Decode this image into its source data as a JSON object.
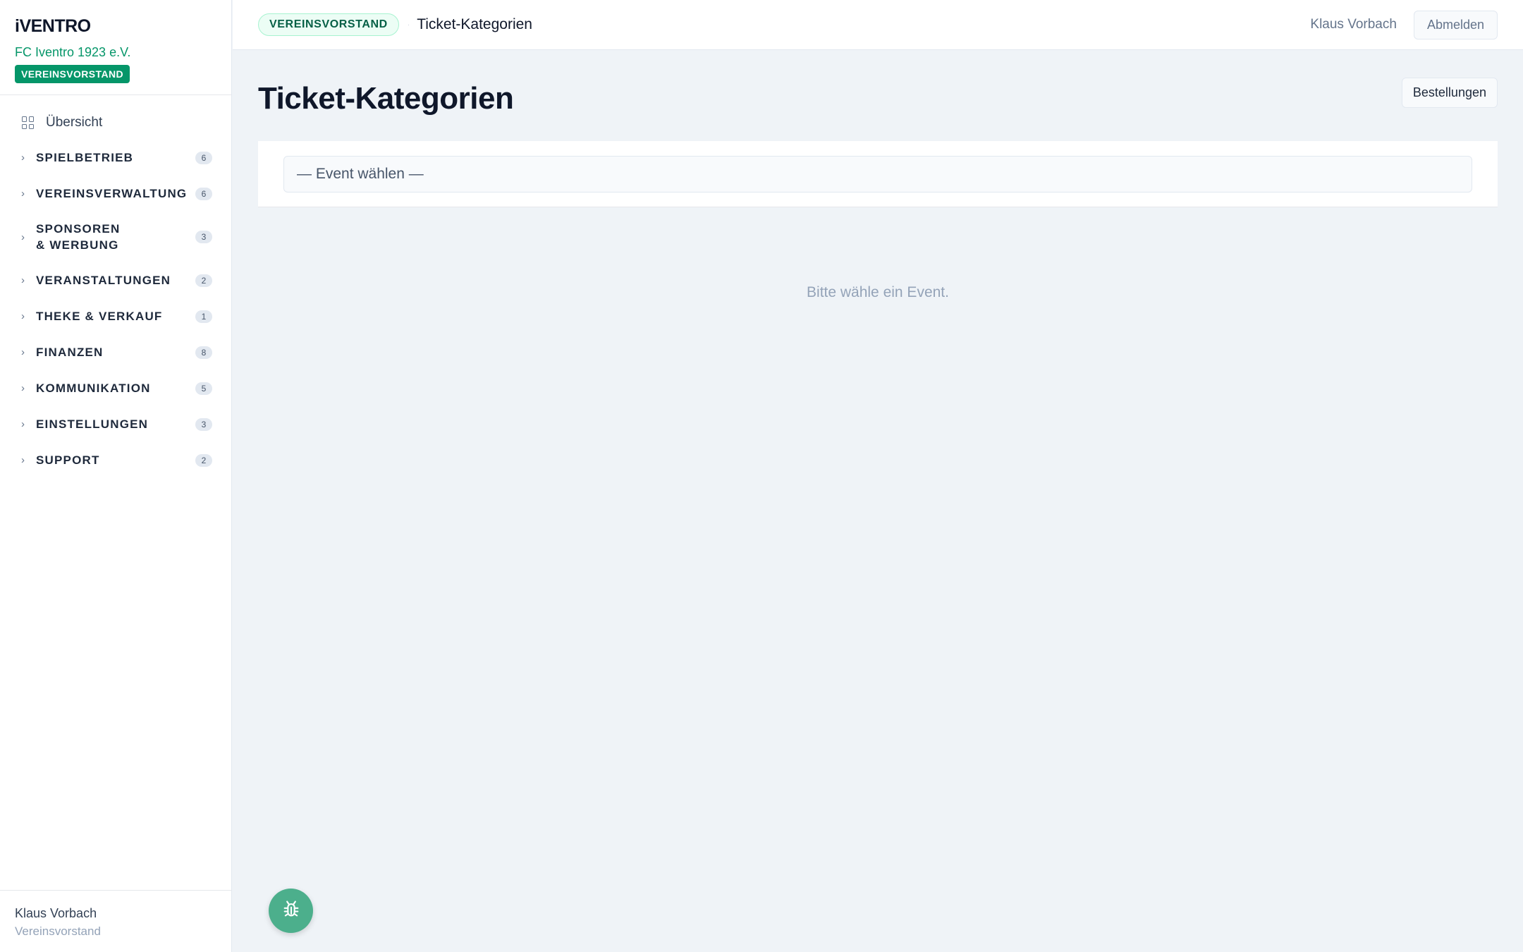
{
  "brand": {
    "logo": "iVENTRO",
    "club": "FC Iventro 1923 e.V.",
    "role_badge": "VEREINSVORSTAND"
  },
  "nav": {
    "overview": "Übersicht",
    "items": [
      {
        "label": "SPIELBETRIEB",
        "count": "6"
      },
      {
        "label": "VEREINSVERWALTUNG",
        "count": "6"
      },
      {
        "label": "SPONSOREN & WERBUNG",
        "count": "3"
      },
      {
        "label": "VERANSTALTUNGEN",
        "count": "2"
      },
      {
        "label": "THEKE & VERKAUF",
        "count": "1"
      },
      {
        "label": "FINANZEN",
        "count": "8"
      },
      {
        "label": "KOMMUNIKATION",
        "count": "5"
      },
      {
        "label": "EINSTELLUNGEN",
        "count": "3"
      },
      {
        "label": "SUPPORT",
        "count": "2"
      }
    ]
  },
  "footer": {
    "name": "Klaus Vorbach",
    "role": "Vereinsvorstand"
  },
  "topbar": {
    "role_pill": "VEREINSVORSTAND",
    "separator": "·",
    "breadcrumb_title": "Ticket-Kategorien",
    "user": "Klaus Vorbach",
    "logout": "Abmelden"
  },
  "main": {
    "title": "Ticket-Kategorien",
    "orders_button": "Bestellungen",
    "event_select_value": "— Event wählen —",
    "empty_text": "Bitte wähle ein Event."
  },
  "icons": {
    "overview": "grid-icon",
    "nav_chevron": "chevron-right-icon",
    "fab": "bug-icon"
  },
  "colors": {
    "accent": "#059669",
    "fab": "#4caf8c",
    "background": "#eff3f7"
  }
}
